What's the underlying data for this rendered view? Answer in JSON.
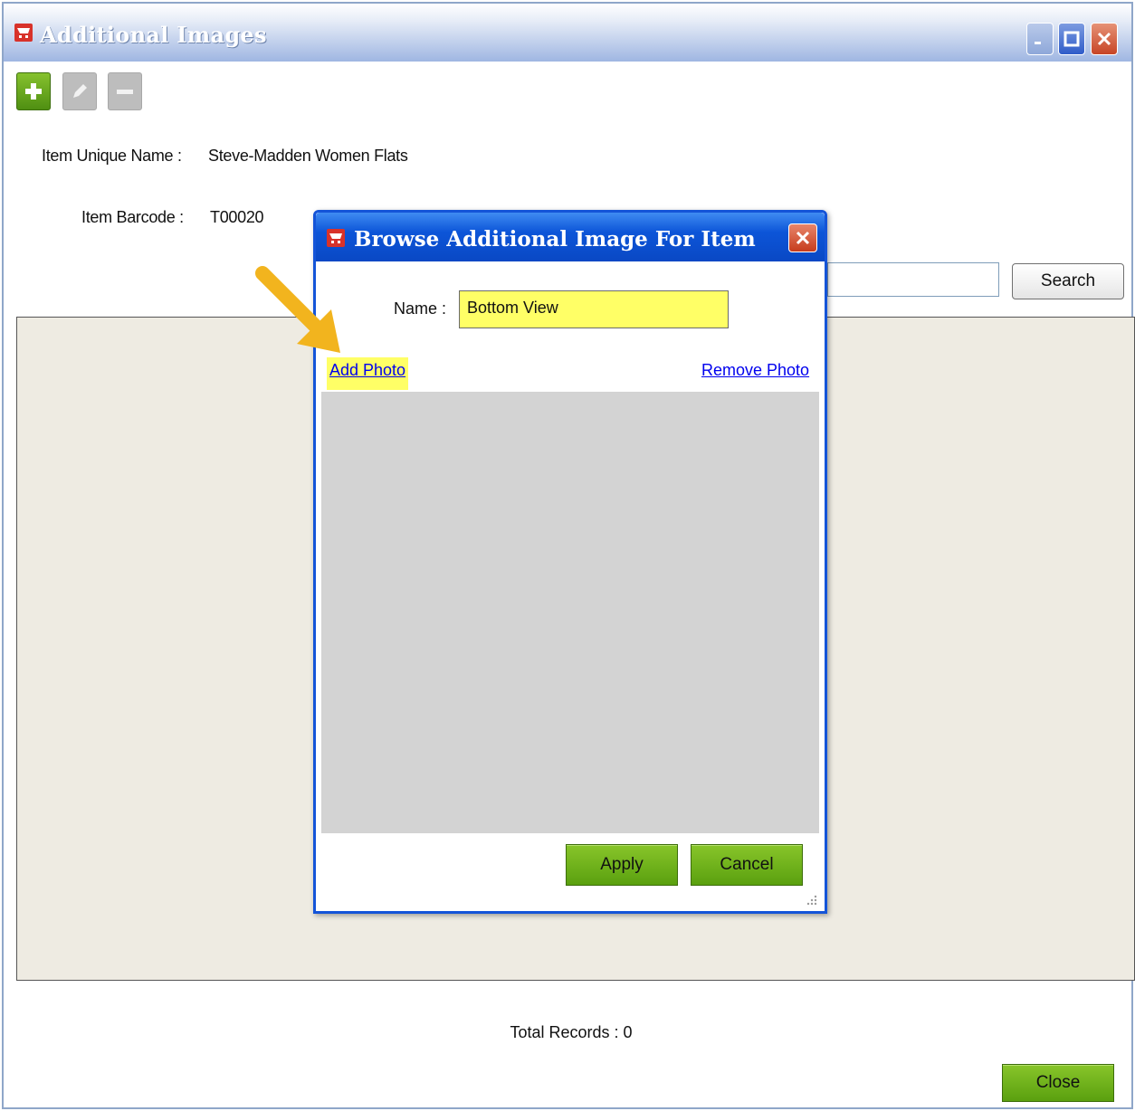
{
  "window": {
    "title": "Additional Images",
    "colors": {
      "titlebar": "#9fb6e2",
      "grid_bg": "#eeebe2",
      "green": "#6fae1c"
    }
  },
  "toolbar": {
    "add_icon": "plus-icon",
    "edit_icon": "pencil-icon",
    "delete_icon": "minus-icon"
  },
  "item": {
    "unique_name_label": "Item Unique Name :",
    "unique_name_value": "Steve-Madden Women Flats",
    "barcode_label": "Item Barcode :",
    "barcode_value": "T00020"
  },
  "search": {
    "value": "",
    "button_label": "Search"
  },
  "footer": {
    "total_records": "Total Records : 0",
    "close_label": "Close"
  },
  "dialog": {
    "title": "Browse Additional Image For Item",
    "name_label": "Name :",
    "name_value": "Bottom View",
    "add_photo_label": "Add Photo",
    "remove_photo_label": "Remove Photo",
    "apply_label": "Apply",
    "cancel_label": "Cancel",
    "colors": {
      "highlight": "#ffff66",
      "titlebar": "#0c55d8",
      "photo_bg": "#d3d3d3"
    }
  }
}
